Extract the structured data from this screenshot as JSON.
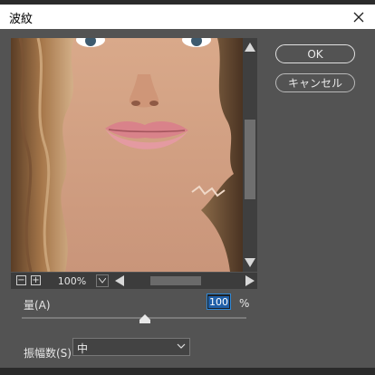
{
  "dialog": {
    "title": "波紋",
    "ok_label": "OK",
    "cancel_label": "キャンセル"
  },
  "preview": {
    "zoom": "100%",
    "zoom_out_symbol": "−",
    "zoom_in_symbol": "+"
  },
  "amount": {
    "label": "量(A)",
    "value": "100",
    "unit": "%",
    "slider_level_percent": 55
  },
  "amplitude": {
    "label": "振幅数(S)",
    "selected": "中"
  },
  "colors": {
    "dialog_bg": "#535353",
    "titlebar_bg": "#ffffff",
    "input_focus": "#2f88d6"
  }
}
